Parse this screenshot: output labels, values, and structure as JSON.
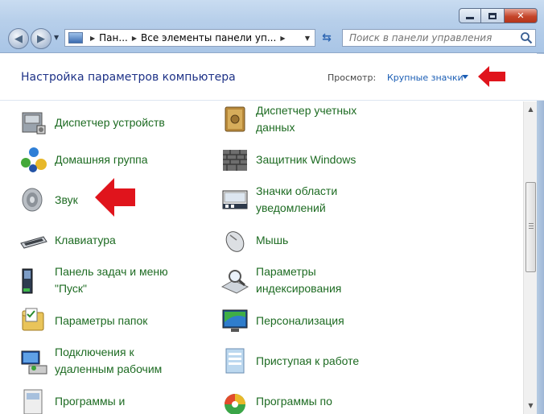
{
  "address": {
    "crumbs": [
      "Пан...",
      "Все элементы панели уп..."
    ]
  },
  "search": {
    "placeholder": "Поиск в панели управления"
  },
  "header": {
    "title": "Настройка параметров компьютера",
    "view_label": "Просмотр:",
    "view_value": "Крупные значки"
  },
  "items_left": [
    {
      "label": "Диспетчер устройств",
      "icon": "device-manager-icon"
    },
    {
      "label": "Домашняя группа",
      "icon": "homegroup-icon"
    },
    {
      "label": "Звук",
      "icon": "speaker-icon"
    },
    {
      "label": "Клавиатура",
      "icon": "keyboard-icon"
    },
    {
      "label": "Панель задач и меню \"Пуск\"",
      "icon": "taskbar-icon"
    },
    {
      "label": "Параметры папок",
      "icon": "folder-options-icon"
    },
    {
      "label": "Подключения к удаленным рабочим",
      "icon": "remote-desktop-icon"
    },
    {
      "label": "Программы и",
      "icon": "programs-icon"
    }
  ],
  "items_right": [
    {
      "label": "Диспетчер учетных данных",
      "icon": "credential-vault-icon"
    },
    {
      "label": "Защитник Windows",
      "icon": "firewall-wall-icon"
    },
    {
      "label": "Значки области уведомлений",
      "icon": "notification-area-icon"
    },
    {
      "label": "Мышь",
      "icon": "mouse-icon"
    },
    {
      "label": "Параметры индексирования",
      "icon": "indexing-icon"
    },
    {
      "label": "Персонализация",
      "icon": "personalization-icon"
    },
    {
      "label": "Приступая к работе",
      "icon": "getting-started-icon"
    },
    {
      "label": "Программы по",
      "icon": "default-programs-icon"
    }
  ],
  "colors": {
    "link_green": "#1d6b22",
    "title_blue": "#1e3287",
    "annotation_red": "#e0141c"
  }
}
